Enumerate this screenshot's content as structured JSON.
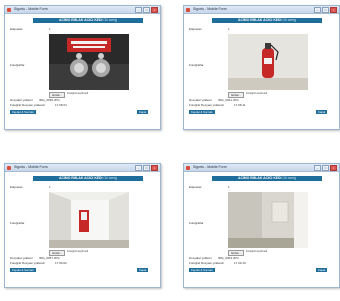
{
  "window_title": "Sigortu - Mobile Form",
  "header": {
    "title": "ACIMO EMLAK ACICI KEDI",
    "subtitle": "Oti Icerig"
  },
  "labels": {
    "field_1": "Etiquetas",
    "field_2": "Fotoğraflar",
    "meta_1": "Dosyalar yüklemi",
    "meta_2": "Fotoğraf Dosyası yüklendi"
  },
  "panels": [
    {
      "meta_1_value": "IMG_0035.JPG",
      "meta_2_value": "17.08.04"
    },
    {
      "meta_1_value": "IMG_0041.JPG",
      "meta_2_value": "17.08.11"
    },
    {
      "meta_1_value": "IMG_0057.JPG",
      "meta_2_value": "17.09.02"
    },
    {
      "meta_1_value": "IMG_0063.JPG",
      "meta_2_value": "17.09.19"
    }
  ],
  "buttons": {
    "browse": "Gözat...",
    "browse_note": "Fotoğraf seçilmedi",
    "left": "Kaydet & Sonraki",
    "right": "Kapat"
  },
  "colors": {
    "header": "#1e6d9a",
    "window_border": "#9fb6d0"
  }
}
